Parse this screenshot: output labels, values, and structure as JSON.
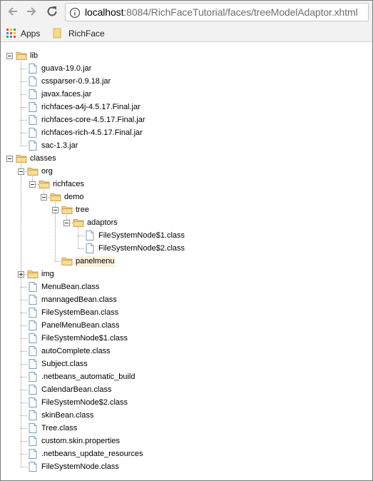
{
  "browser": {
    "url_host": "localhost",
    "url_rest": ":8084/RichFaceTutorial/faces/treeModelAdaptor.xhtml",
    "icons": {
      "back": "back-arrow-icon",
      "forward": "forward-arrow-icon",
      "reload": "reload-icon",
      "info": "info-icon"
    }
  },
  "bookmarks": {
    "apps_label": "Apps",
    "richface_label": "RichFace"
  },
  "tree": {
    "nodes": [
      {
        "label": "lib",
        "type": "folder",
        "state": "expanded",
        "depth": 0
      },
      {
        "label": "guava-19.0.jar",
        "type": "file",
        "depth": 1
      },
      {
        "label": "cssparser-0.9.18.jar",
        "type": "file",
        "depth": 1
      },
      {
        "label": "javax.faces.jar",
        "type": "file",
        "depth": 1
      },
      {
        "label": "richfaces-a4j-4.5.17.Final.jar",
        "type": "file",
        "depth": 1
      },
      {
        "label": "richfaces-core-4.5.17.Final.jar",
        "type": "file",
        "depth": 1
      },
      {
        "label": "richfaces-rich-4.5.17.Final.jar",
        "type": "file",
        "depth": 1
      },
      {
        "label": "sac-1.3.jar",
        "type": "file",
        "depth": 1
      },
      {
        "label": "classes",
        "type": "folder",
        "state": "expanded",
        "depth": 0
      },
      {
        "label": "org",
        "type": "folder",
        "state": "expanded",
        "depth": 1
      },
      {
        "label": "richfaces",
        "type": "folder",
        "state": "expanded",
        "depth": 2
      },
      {
        "label": "demo",
        "type": "folder",
        "state": "expanded",
        "depth": 3
      },
      {
        "label": "tree",
        "type": "folder",
        "state": "expanded",
        "depth": 4
      },
      {
        "label": "adaptors",
        "type": "folder",
        "state": "expanded",
        "depth": 5
      },
      {
        "label": "FileSystemNode$1.class",
        "type": "file",
        "depth": 6
      },
      {
        "label": "FileSystemNode$2.class",
        "type": "file",
        "depth": 6
      },
      {
        "label": "panelmenu",
        "type": "folder",
        "state": "leaf",
        "depth": 4,
        "selected": true
      },
      {
        "label": "img",
        "type": "folder",
        "state": "collapsed",
        "depth": 1
      },
      {
        "label": "MenuBean.class",
        "type": "file",
        "depth": 1
      },
      {
        "label": "mannagedBean.class",
        "type": "file",
        "depth": 1
      },
      {
        "label": "FileSystemBean.class",
        "type": "file",
        "depth": 1
      },
      {
        "label": "PanelMenuBean.class",
        "type": "file",
        "depth": 1
      },
      {
        "label": "FileSystemNode$1.class",
        "type": "file",
        "depth": 1
      },
      {
        "label": "autoComplete.class",
        "type": "file",
        "depth": 1
      },
      {
        "label": "Subject.class",
        "type": "file",
        "depth": 1
      },
      {
        "label": ".netbeans_automatic_build",
        "type": "file",
        "depth": 1
      },
      {
        "label": "CalendarBean.class",
        "type": "file",
        "depth": 1
      },
      {
        "label": "FileSystemNode$2.class",
        "type": "file",
        "depth": 1
      },
      {
        "label": "skinBean.class",
        "type": "file",
        "depth": 1
      },
      {
        "label": "Tree.class",
        "type": "file",
        "depth": 1
      },
      {
        "label": "custom.skin.properties",
        "type": "file",
        "depth": 1
      },
      {
        "label": ".netbeans_update_resources",
        "type": "file",
        "depth": 1
      },
      {
        "label": "FileSystemNode.class",
        "type": "file",
        "depth": 1
      }
    ]
  }
}
